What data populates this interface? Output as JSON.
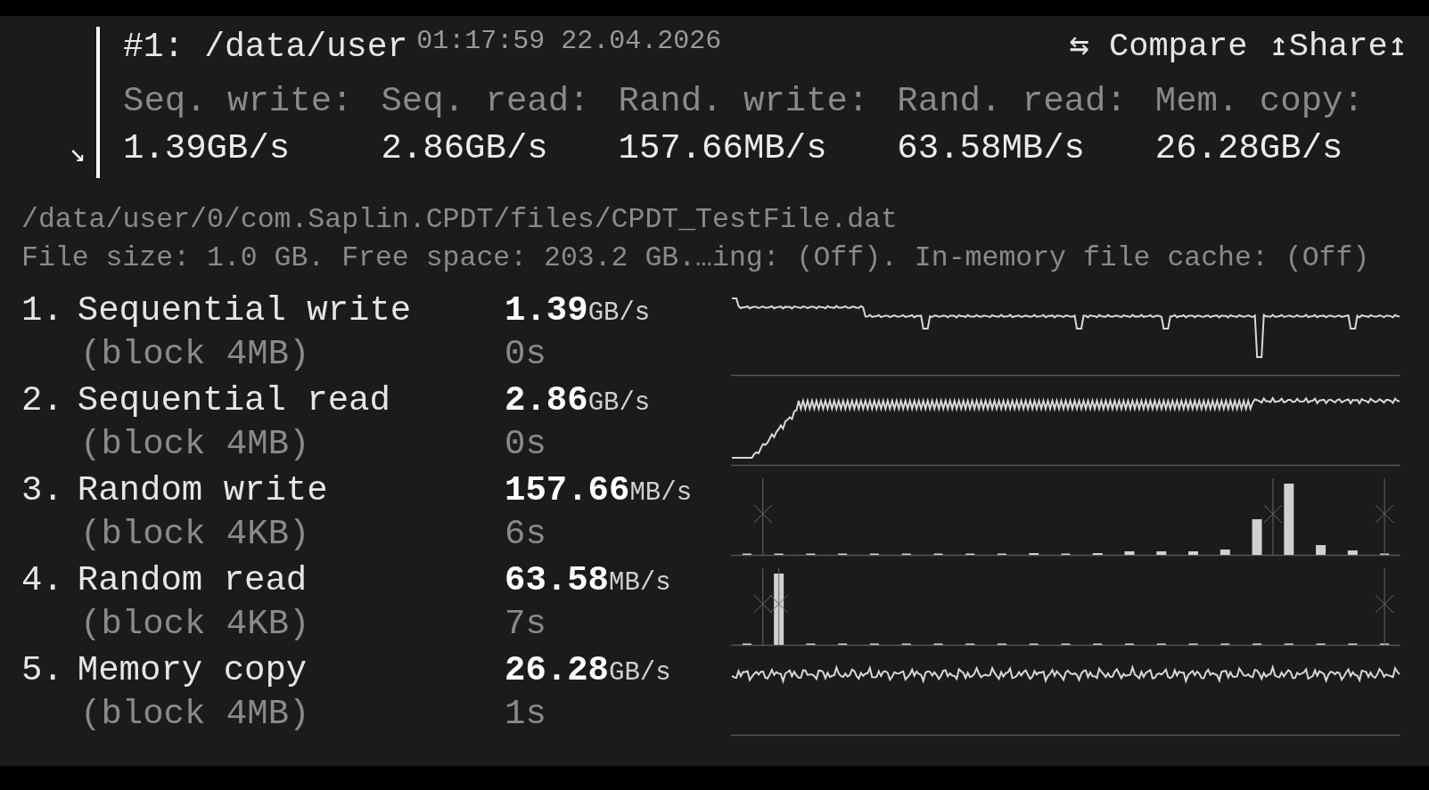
{
  "header": {
    "toggle": "↘",
    "title": "#1: /data/user",
    "timestamp": "01:17:59 22.04.2026",
    "compare": "⇆ Compare",
    "share": "↥Share↥",
    "summary": [
      {
        "label": "Seq. write:",
        "value": "1.39GB/s"
      },
      {
        "label": "Seq. read:",
        "value": "2.86GB/s"
      },
      {
        "label": "Rand. write:",
        "value": "157.66MB/s"
      },
      {
        "label": "Rand. read:",
        "value": "63.58MB/s"
      },
      {
        "label": "Mem. copy:",
        "value": "26.28GB/s"
      }
    ]
  },
  "file": {
    "path": "/data/user/0/com.Saplin.CPDT/files/CPDT_TestFile.dat",
    "info": "File size: 1.0 GB. Free space: 203.2 GB.…ing: (Off). In-memory file cache: (Off)"
  },
  "tests": [
    {
      "index": "1.",
      "name": "Sequential write",
      "block": "(block 4MB)",
      "speed": "1.39",
      "unit": "GB/s",
      "time": "0s",
      "kind": "line"
    },
    {
      "index": "2.",
      "name": "Sequential read",
      "block": "(block 4MB)",
      "speed": "2.86",
      "unit": "GB/s",
      "time": "0s",
      "kind": "line"
    },
    {
      "index": "3.",
      "name": "Random write",
      "block": "(block 4KB)",
      "speed": "157.66",
      "unit": "MB/s",
      "time": "6s",
      "kind": "histogram"
    },
    {
      "index": "4.",
      "name": "Random read",
      "block": "(block 4KB)",
      "speed": "63.58",
      "unit": "MB/s",
      "time": "7s",
      "kind": "histogram"
    },
    {
      "index": "5.",
      "name": "Memory copy",
      "block": "(block 4MB)",
      "speed": "26.28",
      "unit": "GB/s",
      "time": "1s",
      "kind": "line"
    }
  ]
}
